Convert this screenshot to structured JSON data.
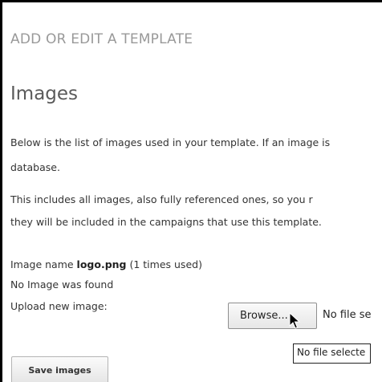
{
  "page": {
    "heading": "ADD OR EDIT A TEMPLATE"
  },
  "images_section": {
    "heading": "Images",
    "intro_line1": "Below is the list of images used in your template. If an image is",
    "intro_line2": "database.",
    "note_line1": "This includes all images, also fully referenced ones, so you r",
    "note_line2": "they will be included in the campaigns that use this template."
  },
  "image_entry": {
    "name_label": "Image name ",
    "file_name": "logo.png",
    "usage": " (1 times used)",
    "status": "No Image was found",
    "upload_label": "Upload new image:"
  },
  "file_input": {
    "browse_label": "Browse...",
    "status_text": "No file se",
    "tooltip": "No file selecte"
  },
  "actions": {
    "save_label": "Save images"
  }
}
